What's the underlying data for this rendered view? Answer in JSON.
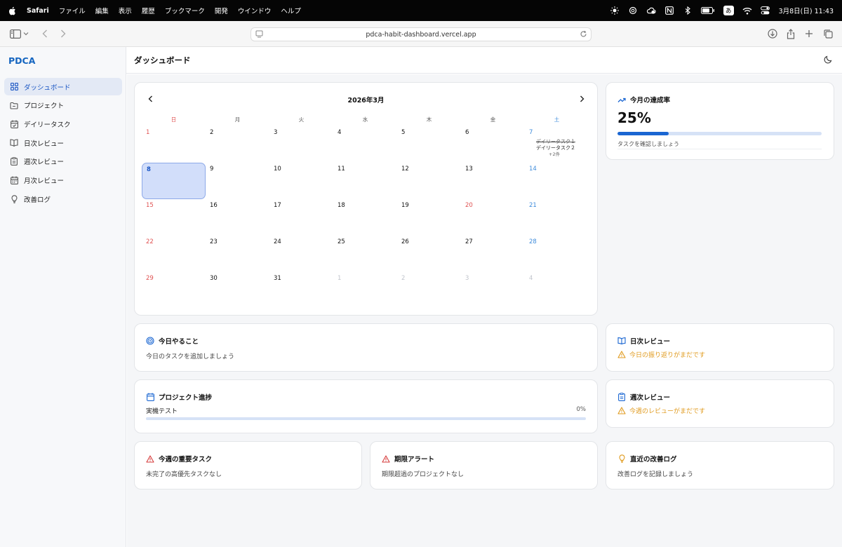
{
  "menubar": {
    "app_name": "Safari",
    "items": [
      "ファイル",
      "編集",
      "表示",
      "履歴",
      "ブックマーク",
      "開発",
      "ウインドウ",
      "ヘルプ"
    ],
    "input_mode": "あ",
    "datetime": "3月8日(日)  11:43"
  },
  "browser": {
    "url": "pdca-habit-dashboard.vercel.app"
  },
  "sidebar": {
    "brand": "PDCA",
    "items": [
      {
        "label": "ダッシュボード",
        "icon": "grid-icon",
        "active": true
      },
      {
        "label": "プロジェクト",
        "icon": "folder-icon",
        "active": false
      },
      {
        "label": "デイリータスク",
        "icon": "calendar-check-icon",
        "active": false
      },
      {
        "label": "日次レビュー",
        "icon": "book-icon",
        "active": false
      },
      {
        "label": "週次レビュー",
        "icon": "clipboard-icon",
        "active": false
      },
      {
        "label": "月次レビュー",
        "icon": "calendar-icon",
        "active": false
      },
      {
        "label": "改善ログ",
        "icon": "lightbulb-icon",
        "active": false
      }
    ]
  },
  "header": {
    "title": "ダッシュボード"
  },
  "calendar": {
    "title": "2026年3月",
    "weekdays": [
      "日",
      "月",
      "火",
      "水",
      "木",
      "金",
      "土"
    ],
    "weeks": [
      [
        "1",
        "2",
        "3",
        "4",
        "5",
        "6",
        "7"
      ],
      [
        "8",
        "9",
        "10",
        "11",
        "12",
        "13",
        "14"
      ],
      [
        "15",
        "16",
        "17",
        "18",
        "19",
        "20",
        "21"
      ],
      [
        "22",
        "23",
        "24",
        "25",
        "26",
        "27",
        "28"
      ],
      [
        "29",
        "30",
        "31",
        "1",
        "2",
        "3",
        "4"
      ]
    ],
    "holiday": "20",
    "today": "8",
    "events_day": "7",
    "events": [
      {
        "label": "デイリータスク１",
        "done": true
      },
      {
        "label": "デイリータスク２",
        "done": false
      }
    ],
    "more": "+2件"
  },
  "achievement": {
    "title": "今月の達成率",
    "percent": "25%",
    "progress": 0.25,
    "note": "タスクを確認しましょう"
  },
  "today_todo": {
    "title": "今日やること",
    "text": "今日のタスクを追加しましょう"
  },
  "daily_review": {
    "title": "日次レビュー",
    "warning": "今日の振り返りがまだです"
  },
  "project_progress": {
    "title": "プロジェクト進捗",
    "projects": [
      {
        "name": "実機テスト",
        "percent": "0%",
        "progress": 0
      }
    ]
  },
  "weekly_review": {
    "title": "週次レビュー",
    "warning": "今週のレビューがまだです"
  },
  "important_tasks": {
    "title": "今週の重要タスク",
    "text": "未完了の高優先タスクなし"
  },
  "deadline_alert": {
    "title": "期限アラート",
    "text": "期限超過のプロジェクトなし"
  },
  "improvement_log": {
    "title": "直近の改善ログ",
    "text": "改善ログを記録しましょう"
  },
  "colors": {
    "accent": "#1a66d2",
    "sunday": "#e05252",
    "saturday": "#3d8bdb",
    "warning": "#e09a1d",
    "alert": "#d63c3c"
  }
}
